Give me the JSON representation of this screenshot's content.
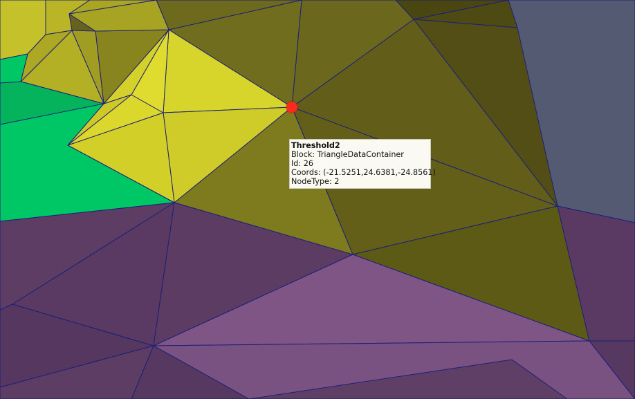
{
  "tooltip": {
    "title": "Threshold2",
    "block_line": "Block: TriangleDataContainer",
    "id_line": "Id: 26",
    "coords_line": "Coords: (-21.5251,24.6381,-24.8561)",
    "nodetype_line": "NodeType: 2"
  },
  "colors": {
    "picked_point": "#ff2a1f",
    "mesh_edge": "#1b1f7a",
    "region_green": "#00c765",
    "region_yellow": "#d3cf2a",
    "region_olive": "#6e6a1e",
    "region_purple": "#5d3e66",
    "region_slate": "#545a72"
  }
}
